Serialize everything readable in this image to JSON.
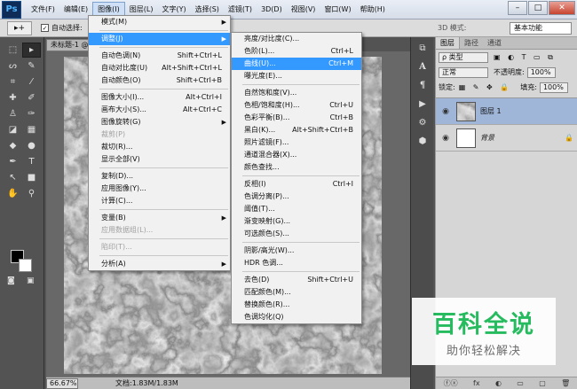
{
  "app": {
    "logo": "Ps",
    "menus": [
      "文件(F)",
      "编辑(E)",
      "图像(I)",
      "图层(L)",
      "文字(Y)",
      "选择(S)",
      "滤镜(T)",
      "3D(D)",
      "视图(V)",
      "窗口(W)",
      "帮助(H)"
    ],
    "active_menu_index": 2
  },
  "window_controls": {
    "minimize": "–",
    "maximize": "□",
    "close": "✕"
  },
  "options_bar": {
    "tool": "▸+",
    "auto_select_label": "自动选择:",
    "mode_3d": "3D 模式:",
    "workspace": "基本功能"
  },
  "document": {
    "tab_title": "未标题-1 @",
    "zoom": "66.67%",
    "doc_info": "文档:1.83M/1.83M"
  },
  "image_menu": [
    {
      "label": "模式(M)",
      "arrow": true
    },
    {
      "sep": true
    },
    {
      "label": "调整(J)",
      "arrow": true,
      "highlight": true
    },
    {
      "sep": true
    },
    {
      "label": "自动色调(N)",
      "shortcut": "Shift+Ctrl+L"
    },
    {
      "label": "自动对比度(U)",
      "shortcut": "Alt+Shift+Ctrl+L"
    },
    {
      "label": "自动颜色(O)",
      "shortcut": "Shift+Ctrl+B"
    },
    {
      "sep": true
    },
    {
      "label": "图像大小(I)...",
      "shortcut": "Alt+Ctrl+I"
    },
    {
      "label": "画布大小(S)...",
      "shortcut": "Alt+Ctrl+C"
    },
    {
      "label": "图像旋转(G)",
      "arrow": true
    },
    {
      "label": "裁剪(P)",
      "disabled": true
    },
    {
      "label": "裁切(R)..."
    },
    {
      "label": "显示全部(V)"
    },
    {
      "sep": true
    },
    {
      "label": "复制(D)..."
    },
    {
      "label": "应用图像(Y)..."
    },
    {
      "label": "计算(C)..."
    },
    {
      "sep": true
    },
    {
      "label": "变量(B)",
      "arrow": true
    },
    {
      "label": "应用数据组(L)...",
      "disabled": true
    },
    {
      "sep": true
    },
    {
      "label": "陷印(T)...",
      "disabled": true
    },
    {
      "sep": true
    },
    {
      "label": "分析(A)",
      "arrow": true
    }
  ],
  "adjust_menu": [
    {
      "label": "亮度/对比度(C)..."
    },
    {
      "label": "色阶(L)...",
      "shortcut": "Ctrl+L"
    },
    {
      "label": "曲线(U)...",
      "shortcut": "Ctrl+M",
      "highlight": true
    },
    {
      "label": "曝光度(E)..."
    },
    {
      "sep": true
    },
    {
      "label": "自然饱和度(V)..."
    },
    {
      "label": "色相/饱和度(H)...",
      "shortcut": "Ctrl+U"
    },
    {
      "label": "色彩平衡(B)...",
      "shortcut": "Ctrl+B"
    },
    {
      "label": "黑白(K)...",
      "shortcut": "Alt+Shift+Ctrl+B"
    },
    {
      "label": "照片滤镜(F)..."
    },
    {
      "label": "通道混合器(X)..."
    },
    {
      "label": "颜色查找..."
    },
    {
      "sep": true
    },
    {
      "label": "反相(I)",
      "shortcut": "Ctrl+I"
    },
    {
      "label": "色调分离(P)..."
    },
    {
      "label": "阈值(T)..."
    },
    {
      "label": "渐变映射(G)..."
    },
    {
      "label": "可选颜色(S)..."
    },
    {
      "sep": true
    },
    {
      "label": "阴影/高光(W)..."
    },
    {
      "label": "HDR 色调..."
    },
    {
      "sep": true
    },
    {
      "label": "去色(D)",
      "shortcut": "Shift+Ctrl+U"
    },
    {
      "label": "匹配颜色(M)..."
    },
    {
      "label": "替换颜色(R)..."
    },
    {
      "label": "色调均化(Q)"
    }
  ],
  "layers_panel": {
    "tabs": [
      "图层",
      "路径",
      "通道"
    ],
    "kind_filter": "ρ 类型",
    "blend_mode": "正常",
    "opacity_label": "不透明度:",
    "opacity_value": "100%",
    "lock_label": "锁定:",
    "fill_label": "填充:",
    "fill_value": "100%",
    "layers": [
      {
        "name": "图层 1",
        "selected": true
      },
      {
        "name": "背景",
        "locked": true
      }
    ],
    "bottom_icons": [
      "ⓕⓧ",
      "fx",
      "◐",
      "▭",
      "▢",
      "🗑"
    ]
  },
  "watermark": {
    "title": "百科全说",
    "subtitle": "助你轻松解决"
  },
  "colors": {
    "highlight": "#3399ff",
    "layer_selected": "#9fb6d9",
    "watermark_green": "#19b955"
  }
}
